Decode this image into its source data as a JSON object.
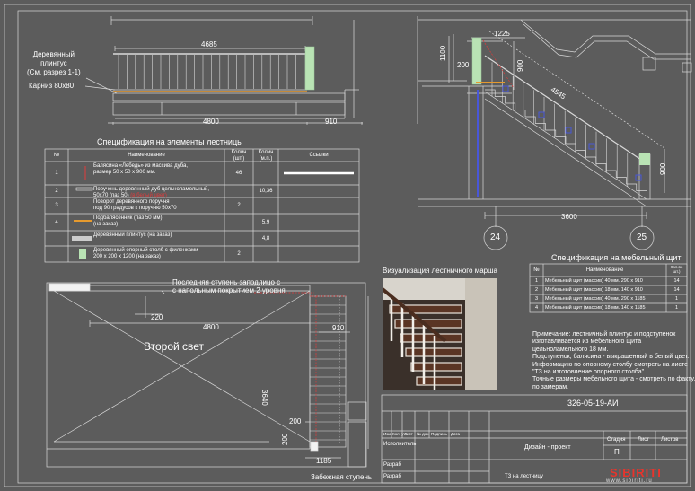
{
  "top_left": {
    "dim_total_top": "4685",
    "label_plinth": "Деревянный\nплинтус\n(См. разрез 1-1)",
    "label_cornice": "Карниз 80x80",
    "dim_bottom": "4800",
    "dim_right": "910"
  },
  "top_right": {
    "dim_top": "1225",
    "dim_left_height": "1100",
    "dim_200": "200",
    "dim_900_top": "900",
    "dim_diag": "4545",
    "dim_900_right": "900",
    "dim_bottom": "3600",
    "axis_left": "24",
    "axis_right": "25"
  },
  "spec_stairs": {
    "title": "Спецификация на элементы лестницы",
    "headers": {
      "num": "№",
      "name": "Наименование",
      "qty_pcs": "Колич (шт.)",
      "qty_m": "Колич (м.п.)",
      "links": "Ссылки"
    },
    "rows": [
      {
        "num": "1",
        "name": "Балясина «Лебедь» из массива дуба,\nразмер 50 x 50 x 900 мм.",
        "qty_pcs": "46",
        "qty_m": ""
      },
      {
        "num": "2",
        "name": "Поручень деревянный дуб цельноламельный,\n50x70 (паз 50)",
        "name_red": "(в белый цвет)",
        "qty_pcs": "",
        "qty_m": "10,36"
      },
      {
        "num": "3",
        "name": "Поворот деревянного поручня\nпод 90 градусов к поручню 50x70",
        "qty_pcs": "2",
        "qty_m": ""
      },
      {
        "num": "4",
        "name": "Подбалясенник  (паз 50 мм)\n(на заказ)",
        "qty_pcs": "",
        "qty_m": "5,9"
      },
      {
        "num": "",
        "name": "Деревянный плинтус   (на заказ)",
        "qty_pcs": "",
        "qty_m": "4,8"
      },
      {
        "num": "",
        "name": "Деревянный опорный столб с филенками\n200 x 200 x 1200   (на заказ)",
        "qty_pcs": "2",
        "qty_m": ""
      }
    ]
  },
  "plan": {
    "note": "Последняя ступень заподлицо с\nс напольным покрытием 2 уровня",
    "dim_220": "220",
    "dim_4800": "4800",
    "dim_910": "910",
    "second_light": "Второй свет",
    "dim_3640": "3640",
    "dim_200a": "200",
    "dim_200b": "200",
    "dim_1185": "1185",
    "winder_label": "Забежная ступень"
  },
  "visual": {
    "title": "Визуализация лестничного марша"
  },
  "spec_furniture": {
    "title": "Спецификация на мебельный щит",
    "headers": {
      "num": "№",
      "name": "Наименование",
      "qty": "Кол.во\nшт.)"
    },
    "rows": [
      {
        "num": "1",
        "name": "Мебельный щит (массив) 40 мм. 290 x 910",
        "qty": "14"
      },
      {
        "num": "2",
        "name": "Мебельный щит (массив) 18 мм. 140 x 910",
        "qty": "14"
      },
      {
        "num": "3",
        "name": "Мебельный щит (массив) 40 мм. 290 x 1185",
        "qty": "1"
      },
      {
        "num": "4",
        "name": "Мебельный щит (массив) 18 мм. 140 x 1185",
        "qty": "1"
      }
    ]
  },
  "notes": [
    "Примечание: лестничный плинтус и подступенок",
    "изготавливается из мебельного щита",
    "цельноламельного 18 мм.",
    "Подступенок, балясина - выкрашенный в белый цвет.",
    "Информацию по опорному столбу смотреть на листе",
    "\"ТЗ на изготовление  опорного столба\"",
    "Точные размеры мебельного щита - смотреть по факту,",
    "по замерам."
  ],
  "title_block": {
    "code": "326-05-19-АИ",
    "col_heads": [
      "Изм.",
      "Кол. уч.",
      "Лист",
      "№ док.",
      "Подпись",
      "Дата"
    ],
    "executor": "Исполнитель",
    "developed1": "Разраб",
    "developed2": "Разраб",
    "project": "Дизайн - проект",
    "stage_h": "Стадия",
    "sheet_h": "Лист",
    "sheets_h": "Листов",
    "stage_v": "П",
    "doc_name": "ТЗ на  лестницу"
  },
  "logo": {
    "name": "SIBIRITI",
    "site": "www.sibiriti.ru"
  }
}
